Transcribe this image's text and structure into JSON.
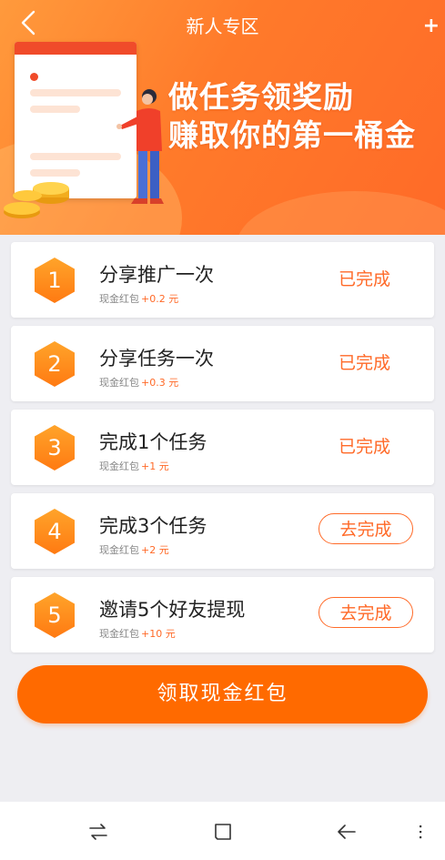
{
  "header": {
    "title": "新人专区",
    "back_icon": "chevron-left-icon",
    "plus_text": "+"
  },
  "banner": {
    "slogan_line1": "做任务领奖励",
    "slogan_line2": "赚取你的第一桶金"
  },
  "tasks": [
    {
      "index": "1",
      "title": "分享推广一次",
      "reward_label": "现金红包",
      "reward_amount": "+0.2 元",
      "status": "已完成",
      "done": true
    },
    {
      "index": "2",
      "title": "分享任务一次",
      "reward_label": "现金红包",
      "reward_amount": "+0.3 元",
      "status": "已完成",
      "done": true
    },
    {
      "index": "3",
      "title": "完成1个任务",
      "reward_label": "现金红包",
      "reward_amount": "+1 元",
      "status": "已完成",
      "done": true
    },
    {
      "index": "4",
      "title": "完成3个任务",
      "reward_label": "现金红包",
      "reward_amount": "+2 元",
      "status": "去完成",
      "done": false
    },
    {
      "index": "5",
      "title": "邀请5个好友提现",
      "reward_label": "现金红包",
      "reward_amount": "+10 元",
      "status": "去完成",
      "done": false
    }
  ],
  "claim_button": {
    "label": "领取现金红包"
  },
  "system_nav": {
    "icons": [
      "switch-arrows-icon",
      "home-square-icon",
      "back-arrow-icon",
      "menu-dots-icon"
    ]
  },
  "colors": {
    "accent": "#ff6a28",
    "button": "#ff6a00",
    "banner_start": "#ff9a3c",
    "banner_end": "#ff6a28",
    "hexagon": "#ff8a1e",
    "background": "#eeeef2"
  }
}
